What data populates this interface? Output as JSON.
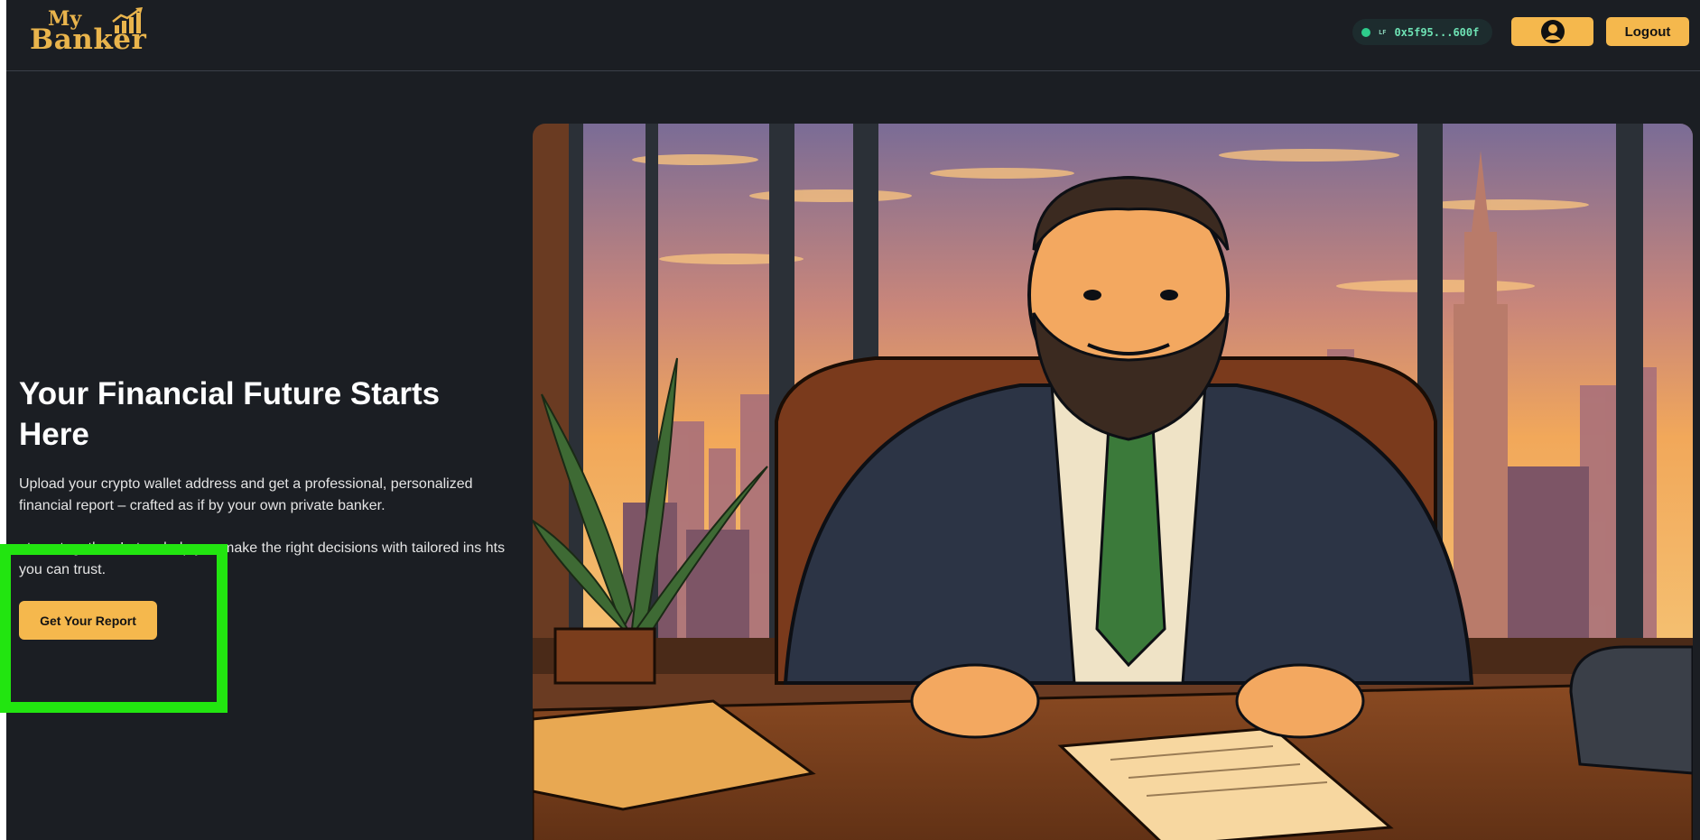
{
  "header": {
    "logo": {
      "line1": "My",
      "line2": "Banker"
    },
    "wallet": {
      "network": "LF",
      "address": "0x5f95...600f",
      "status_color": "#2ecc8b"
    },
    "profile_icon": "user-avatar-icon",
    "logout_label": "Logout"
  },
  "hero": {
    "title": "Your Financial Future Starts Here",
    "paragraph1": "Upload your crypto wallet address and get a professional, personalized financial report – crafted as if by your own private banker.",
    "paragraph2": "uture, together. Let us help you make the right decisions with tailored ins  hts you can trust.",
    "cta_label": "Get Your Report",
    "image_subject": "banker-illustration"
  },
  "colors": {
    "background": "#1b1e23",
    "accent": "#f5b84d",
    "highlight": "#22e510"
  }
}
